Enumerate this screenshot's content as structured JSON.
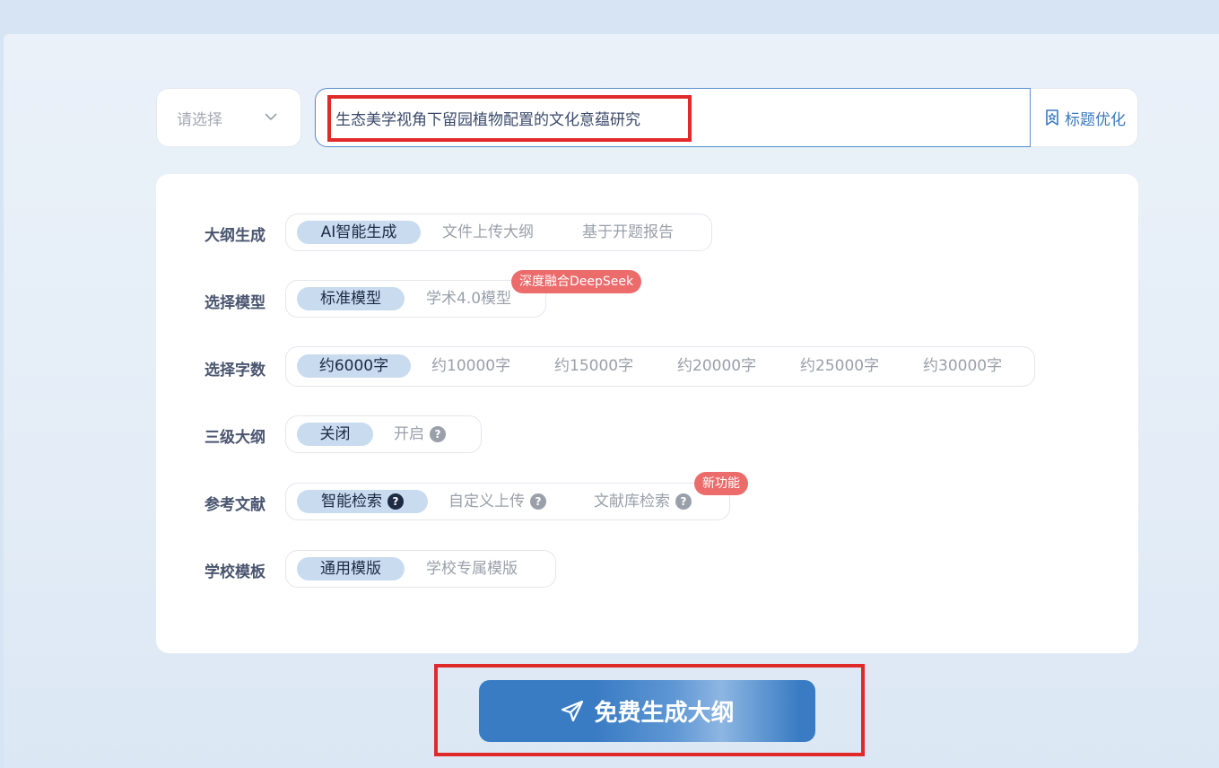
{
  "topic": {
    "select_placeholder": "请选择",
    "title_value": "生态美学视角下留园植物配置的文化意蕴研究",
    "optimize_label": "标题优化"
  },
  "rows": {
    "outline": {
      "label": "大纲生成",
      "options": [
        "AI智能生成",
        "文件上传大纲",
        "基于开题报告"
      ]
    },
    "model": {
      "label": "选择模型",
      "options": [
        "标准模型",
        "学术4.0模型"
      ],
      "badge": "深度融合DeepSeek"
    },
    "words": {
      "label": "选择字数",
      "options": [
        "约6000字",
        "约10000字",
        "约15000字",
        "约20000字",
        "约25000字",
        "约30000字"
      ]
    },
    "level3": {
      "label": "三级大纲",
      "options": [
        "关闭",
        "开启"
      ]
    },
    "refs": {
      "label": "参考文献",
      "options": [
        "智能检索",
        "自定义上传",
        "文献库检索"
      ],
      "badge": "新功能"
    },
    "template": {
      "label": "学校模板",
      "options": [
        "通用模版",
        "学校专属模版"
      ]
    }
  },
  "generate_label": "免费生成大纲",
  "colors": {
    "accent": "#3a7cc4",
    "active_pill": "#c9dbef",
    "badge": "#ec6b6b",
    "highlight_border": "#e02a2a"
  },
  "icons": {
    "select_chevron": "chevron-down-icon",
    "optimize": "bookmark-star-icon",
    "help": "question-circle-icon",
    "generate": "send-icon"
  }
}
